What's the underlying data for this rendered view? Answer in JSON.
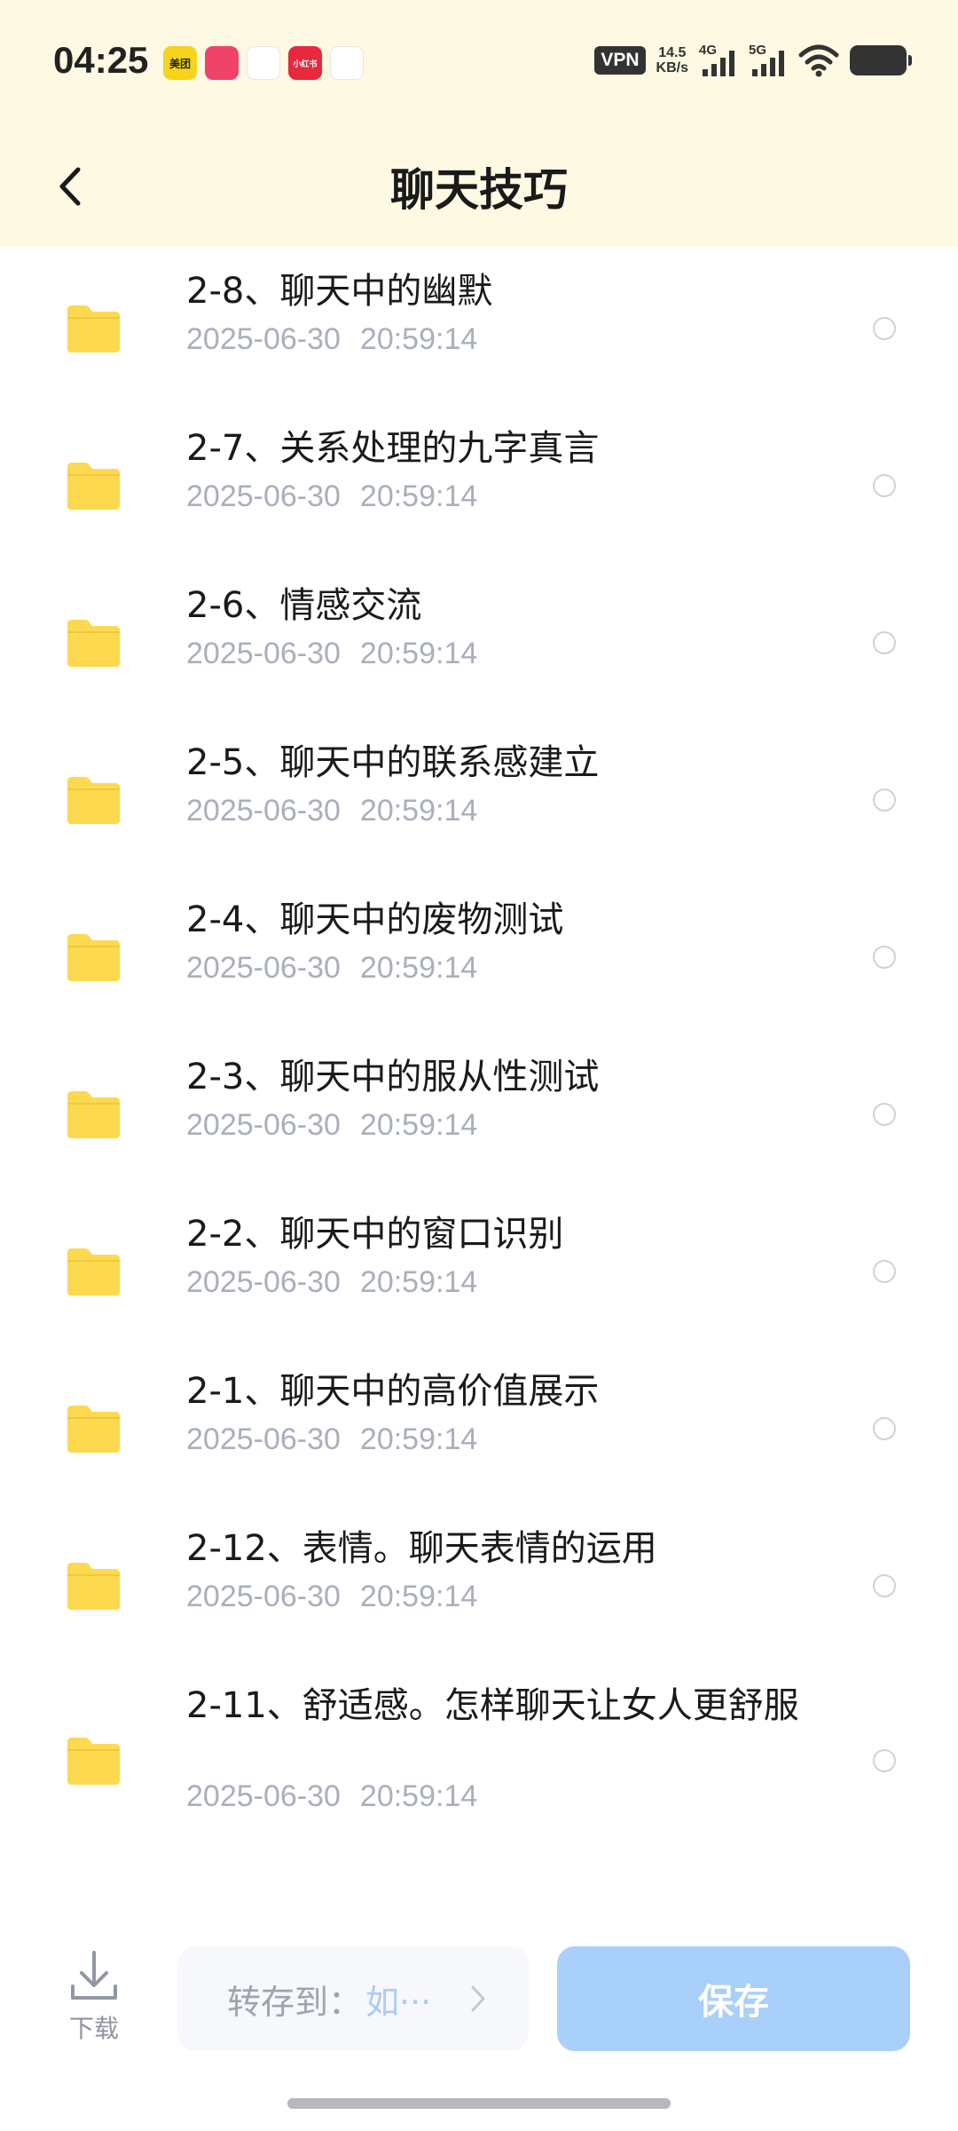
{
  "status_bar": {
    "time": "04:25",
    "app_icons": [
      {
        "name": "meituan-icon",
        "label": "美团",
        "color": "#f7d31b",
        "text_color": "#222"
      },
      {
        "name": "chat-app-icon",
        "label": "",
        "color": "#f0436a",
        "text_color": "#fff"
      },
      {
        "name": "network-app-icon",
        "label": "",
        "color": "#ffffff",
        "text_color": "#2a7de1"
      },
      {
        "name": "xiaohongshu-icon",
        "label": "小红书",
        "color": "#e8283c",
        "text_color": "#fff"
      },
      {
        "name": "triangle-app-icon",
        "label": "",
        "color": "#ffffff",
        "text_color": "#e8283c"
      }
    ],
    "vpn": "VPN",
    "net_speed_value": "14.5",
    "net_speed_unit": "KB/s",
    "signal_1_label": "4G",
    "signal_2_label": "5G"
  },
  "header": {
    "title": "聊天技巧"
  },
  "files": [
    {
      "name": "2-8、聊天中的幽默",
      "date": "2025-06-30",
      "time": "20:59:14"
    },
    {
      "name": "2-7、关系处理的九字真言",
      "date": "2025-06-30",
      "time": "20:59:14"
    },
    {
      "name": "2-6、情感交流",
      "date": "2025-06-30",
      "time": "20:59:14"
    },
    {
      "name": "2-5、聊天中的联系感建立",
      "date": "2025-06-30",
      "time": "20:59:14"
    },
    {
      "name": "2-4、聊天中的废物测试",
      "date": "2025-06-30",
      "time": "20:59:14"
    },
    {
      "name": "2-3、聊天中的服从性测试",
      "date": "2025-06-30",
      "time": "20:59:14"
    },
    {
      "name": "2-2、聊天中的窗口识别",
      "date": "2025-06-30",
      "time": "20:59:14"
    },
    {
      "name": "2-1、聊天中的高价值展示",
      "date": "2025-06-30",
      "time": "20:59:14"
    },
    {
      "name": "2-12、表情。聊天表情的运用",
      "date": "2025-06-30",
      "time": "20:59:14"
    },
    {
      "name": "2-11、舒适感。怎样聊天让女人更舒服",
      "date": "2025-06-30",
      "time": "20:59:14"
    }
  ],
  "bottom_bar": {
    "download_label": "下载",
    "save_to_label": "转存到：",
    "save_to_value": "如···",
    "save_button": "保存"
  },
  "colors": {
    "header_bg": "#fdf9e3",
    "folder": "#fcd94e",
    "save_button": "#a9cffb"
  }
}
